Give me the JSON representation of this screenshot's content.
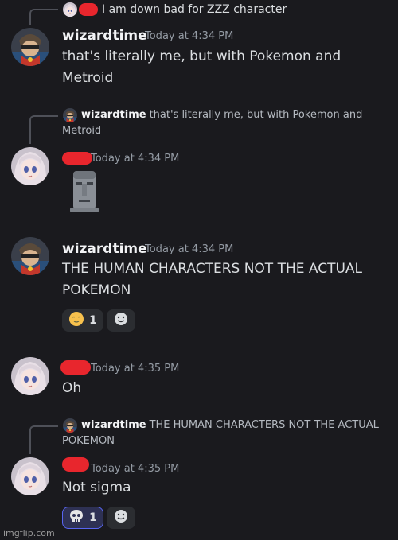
{
  "messages": [
    {
      "reply": {
        "username": "",
        "text": "I am down bad for ZZZ character"
      },
      "username": "wizardtime",
      "timestamp": "Today at 4:34 PM",
      "text": "that's literally me, but with Pokemon and Metroid"
    },
    {
      "reply": {
        "username": "wizardtime",
        "text": "that's literally me, but with Pokemon and Metroid"
      },
      "username": "",
      "timestamp": "Today at 4:34 PM",
      "text": "",
      "emoji_name": "moai-icon"
    },
    {
      "username": "wizardtime",
      "timestamp": "Today at 4:34 PM",
      "text": "THE HUMAN CHARACTERS NOT THE ACTUAL POKEMON",
      "reactions": [
        {
          "emoji_name": "relieved-face-icon",
          "count": "1"
        }
      ]
    },
    {
      "username": "",
      "timestamp": "Today at 4:35 PM",
      "text": "Oh"
    },
    {
      "reply": {
        "username": "wizardtime",
        "text": "THE HUMAN CHARACTERS NOT THE ACTUAL POKEMON"
      },
      "username": "",
      "timestamp": "Today at 4:35 PM",
      "text": "Not sigma",
      "reactions": [
        {
          "emoji_name": "skull-icon",
          "count": "1",
          "active": true
        }
      ]
    }
  ],
  "watermark": "imgflip.com",
  "colors": {
    "background": "#1a1a1e",
    "redaction": "#e8262d",
    "reaction_active_border": "#5865f2"
  }
}
